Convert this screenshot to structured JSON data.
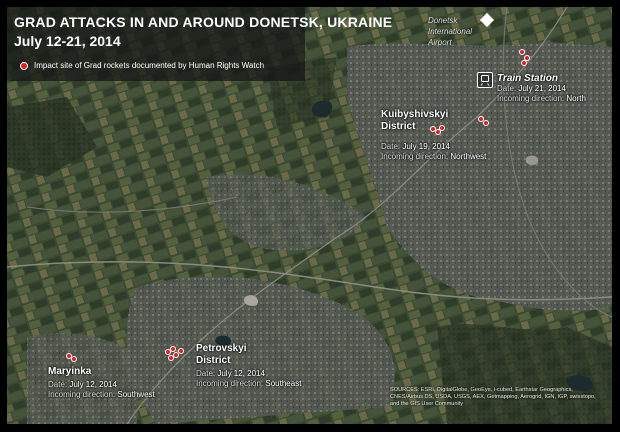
{
  "title": "GRAD ATTACKS IN AND AROUND DONETSK, UKRAINE",
  "subtitle": "July 12-21, 2014",
  "legend": {
    "text": "Impact site of Grad rockets documented by Human Rights Watch",
    "color": "#e02020"
  },
  "airport": {
    "line1": "Donetsk",
    "line2": "International",
    "line3": "Airport",
    "icon": "airport-icon"
  },
  "sites": [
    {
      "name": "Train Station",
      "date_label": "Date:",
      "date": "July 21, 2014",
      "dir_label": "Incoming direction:",
      "dir": "North"
    },
    {
      "name_line1": "Kuibyshivskyi",
      "name_line2": "District",
      "date_label": "Date:",
      "date": "July 19, 2014",
      "dir_label": "Incoming direction:",
      "dir": "Northwest"
    },
    {
      "name_line1": "Petrovskyi",
      "name_line2": "District",
      "date_label": "Date:",
      "date": "July 12, 2014",
      "dir_label": "Incoming direction:",
      "dir": "Southeast"
    },
    {
      "name": "Maryinka",
      "date_label": "Date:",
      "date": "July 12, 2014",
      "dir_label": "Incoming direction:",
      "dir": "Southwest"
    }
  ],
  "sources": "SOURCES: ESRI, DigitalGlobe, GeoEye, i-cubed, Earthstar Geographics, CNES/Airbus DS, USDA, USGS, AEX, Getmapping, Aerogrid, IGN, IGP, swisstopo, and the GIS User Community"
}
